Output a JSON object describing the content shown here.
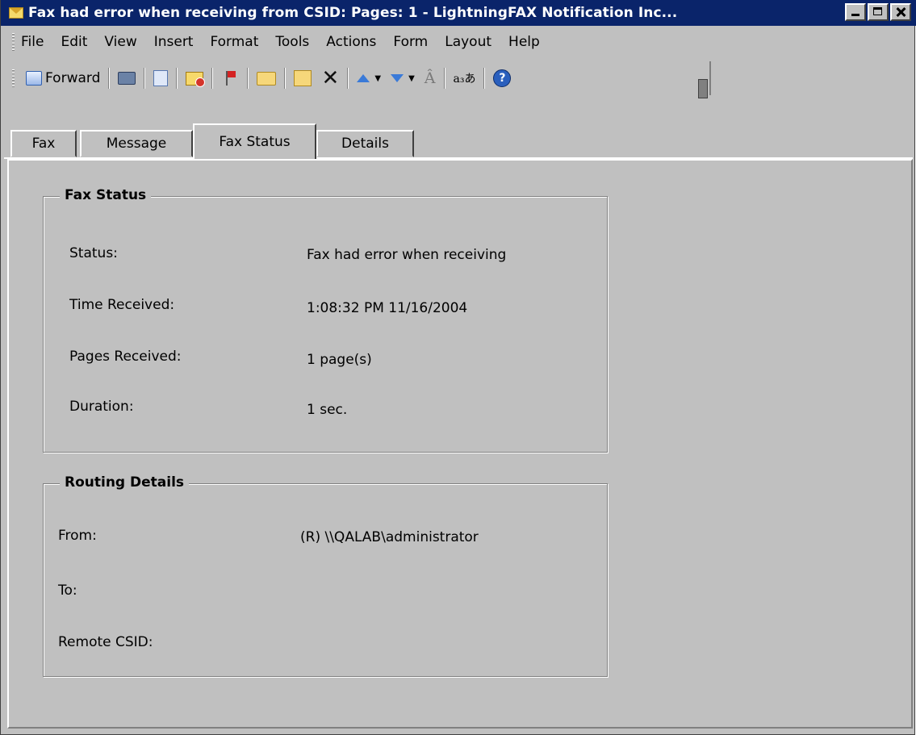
{
  "window": {
    "title": "Fax had error when receiving from CSID:   Pages: 1 - LightningFAX Notification Inc..."
  },
  "menu": [
    "File",
    "Edit",
    "View",
    "Insert",
    "Format",
    "Tools",
    "Actions",
    "Form",
    "Layout",
    "Help"
  ],
  "toolbar": {
    "forward_label": "Forward",
    "font_glyph": "Â",
    "encoding_glyph": "a₃あ",
    "help_glyph": "?"
  },
  "tabs": [
    "Fax",
    "Message",
    "Fax Status",
    "Details"
  ],
  "fax_status": {
    "title": "Fax Status",
    "rows": [
      {
        "label": "Status:",
        "value": "Fax had error when receiving"
      },
      {
        "label": "Time Received:",
        "value": "1:08:32 PM  11/16/2004"
      },
      {
        "label": "Pages Received:",
        "value": "1 page(s)"
      },
      {
        "label": "Duration:",
        "value": "1 sec."
      }
    ]
  },
  "routing": {
    "title": "Routing Details",
    "rows": [
      {
        "label": "From:",
        "value": "(R) \\\\QALAB\\administrator"
      },
      {
        "label": "To:",
        "value": ""
      },
      {
        "label": "Remote CSID:",
        "value": ""
      }
    ]
  }
}
